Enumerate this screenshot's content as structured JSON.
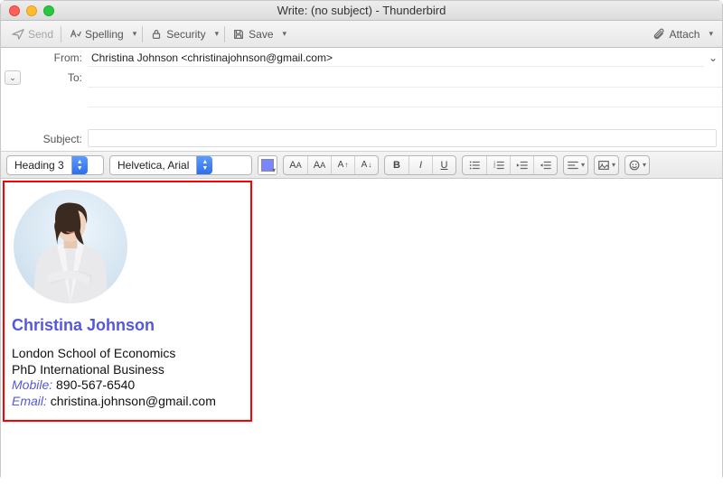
{
  "window": {
    "title": "Write: (no subject) - Thunderbird"
  },
  "toolbar": {
    "send": "Send",
    "spelling": "Spelling",
    "security": "Security",
    "save": "Save",
    "attach": "Attach"
  },
  "headers": {
    "from_label": "From:",
    "from_value": "Christina Johnson <christinajohnson@gmail.com>",
    "to_label": "To:",
    "to_value": "",
    "subject_label": "Subject:",
    "subject_value": ""
  },
  "format": {
    "paragraph_style": "Heading 3",
    "font_family": "Helvetica, Arial",
    "text_color": "#7a86ff"
  },
  "signature": {
    "name": "Christina Johnson",
    "org": "London School of Economics",
    "degree": "PhD International Business",
    "mobile_label": "Mobile:",
    "mobile": "890-567-6540",
    "email_label": "Email:",
    "email": "christina.johnson@gmail.com"
  }
}
